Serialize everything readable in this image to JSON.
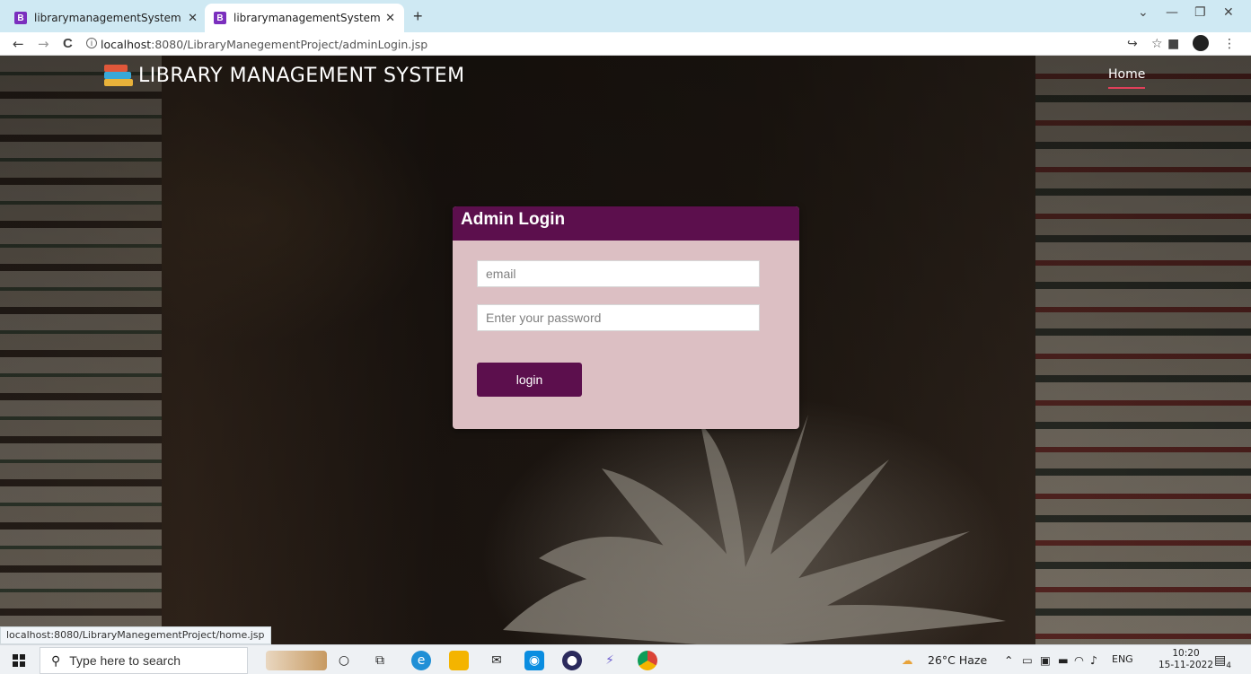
{
  "browser": {
    "tabs": [
      {
        "favicon": "B",
        "title": "librarymanagementSystem",
        "active": false
      },
      {
        "favicon": "B",
        "title": "librarymanagementSystem",
        "active": true
      }
    ],
    "new_tab": "+",
    "window_controls": {
      "minimize": "—",
      "restore": "❐",
      "close": "✕",
      "dropdown": "⌄"
    },
    "nav": {
      "back": "←",
      "forward": "→",
      "reload": "C"
    },
    "url_host": "localhost",
    "url_rest": ":8080/LibraryManegementProject/adminLogin.jsp",
    "right_icons": {
      "share": "↪",
      "star": "☆",
      "sidepanel": "■",
      "menu": "⋮"
    }
  },
  "navbar": {
    "brand_title": "LIBRARY MANAGEMENT SYSTEM",
    "home_label": "Home"
  },
  "login": {
    "title": "Admin Login",
    "email_placeholder": "email",
    "password_placeholder": "Enter your password",
    "button_label": "login"
  },
  "status_url": "localhost:8080/LibraryManegementProject/home.jsp",
  "taskbar": {
    "search_placeholder": "Type here to search",
    "weather": "26°C Haze",
    "language": "ENG",
    "time": "10:20",
    "date": "15-11-2022",
    "notifications": "4"
  },
  "colors": {
    "brand_purple": "#5c0f4d",
    "card_pink": "#dcbfc3",
    "home_underline": "#e0405a"
  }
}
